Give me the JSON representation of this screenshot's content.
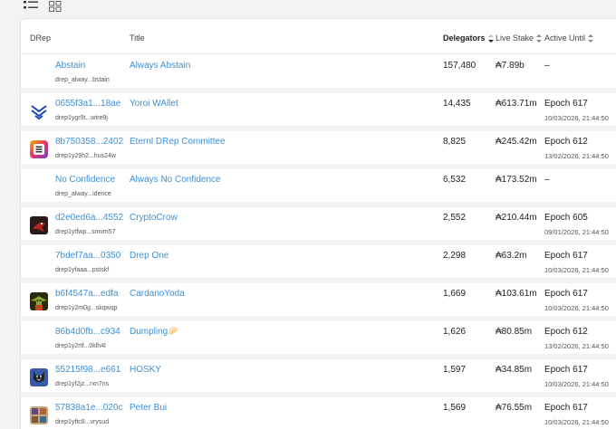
{
  "view_toggle": {
    "list_icon": "list-view-icon",
    "grid_icon": "grid-view-icon"
  },
  "columns": {
    "drep": "DRep",
    "title": "Title",
    "delegators": "Delegators",
    "live_stake": "Live Stake",
    "active_until": "Active Until"
  },
  "rows": [
    {
      "id": "Abstain",
      "sub": "drep_alway...bstain",
      "title": "Always Abstain",
      "delegators": "157,480",
      "stake": "₳7.89b",
      "until": "–",
      "until_date": "",
      "avatar": "none"
    },
    {
      "id": "0655f3a1...18ae",
      "sub": "drep1ygr9t...wtre9j",
      "title": "Yoroi WAllet",
      "delegators": "14,435",
      "stake": "₳613.71m",
      "until": "Epoch 617",
      "until_date": "10/03/2026, 21:44:50",
      "avatar": "yoroi"
    },
    {
      "id": "8b750358...2402",
      "sub": "drep1y29h2...hus24w",
      "title": "Eternl DRep Committee",
      "delegators": "8,825",
      "stake": "₳245.42m",
      "until": "Epoch 612",
      "until_date": "13/02/2026, 21:44:50",
      "avatar": "eternl"
    },
    {
      "id": "No Confidence",
      "sub": "drep_alway...idence",
      "title": "Always No Confidence",
      "delegators": "6,532",
      "stake": "₳173.52m",
      "until": "–",
      "until_date": "",
      "avatar": "none"
    },
    {
      "id": "d2e0ed6a...4552",
      "sub": "drep1ytfwp...smvm57",
      "title": "CryptoCrow",
      "delegators": "2,552",
      "stake": "₳210.44m",
      "until": "Epoch 605",
      "until_date": "09/01/2026, 21:44:50",
      "avatar": "crow"
    },
    {
      "id": "7bdef7aa...0350",
      "sub": "drep1yfaaa...pstskf",
      "title": "Drep One",
      "delegators": "2,298",
      "stake": "₳63.2m",
      "until": "Epoch 617",
      "until_date": "10/03/2026, 21:44:50",
      "avatar": "none"
    },
    {
      "id": "b6f4547a...edfa",
      "sub": "drep1y2m0g...skqwqp",
      "title": "CardanoYoda",
      "delegators": "1,669",
      "stake": "₳103.61m",
      "until": "Epoch 617",
      "until_date": "10/03/2026, 21:44:50",
      "avatar": "yoda"
    },
    {
      "id": "86b4d0fb...c934",
      "sub": "drep1y2rtf...0klh4l",
      "title": "Dumpling🥟",
      "delegators": "1,626",
      "stake": "₳80.85m",
      "until": "Epoch 612",
      "until_date": "13/02/2026, 21:44:50",
      "avatar": "none"
    },
    {
      "id": "55215f98...e661",
      "sub": "drep1yf2jz...rxn7ns",
      "title": "HOSKY",
      "delegators": "1,597",
      "stake": "₳34.85m",
      "until": "Epoch 617",
      "until_date": "10/03/2026, 21:44:50",
      "avatar": "hosky"
    },
    {
      "id": "57838a1e...020c",
      "sub": "drep1yftc8...vrysud",
      "title": "Peter Bui",
      "delegators": "1,569",
      "stake": "₳76.55m",
      "until": "Epoch 617",
      "until_date": "10/03/2026, 21:44:50",
      "avatar": "peter"
    }
  ]
}
